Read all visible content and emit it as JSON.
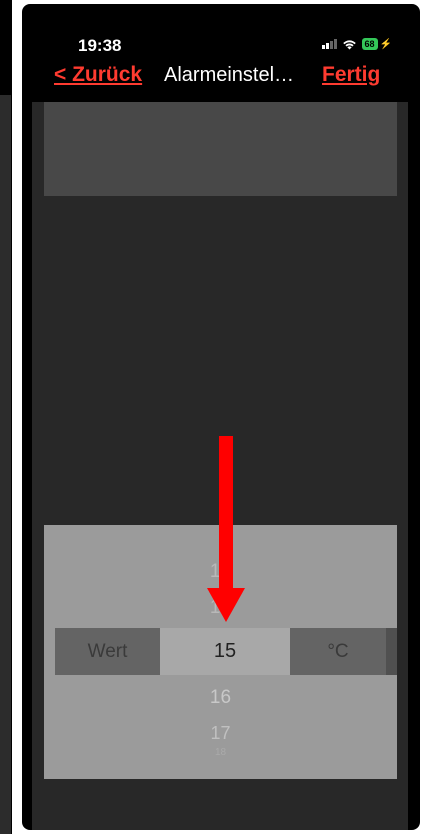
{
  "status_bar": {
    "time": "19:38",
    "battery": "68",
    "icons": [
      "signal-icon",
      "wifi-icon",
      "battery-icon"
    ]
  },
  "nav": {
    "back_label": "< Zurück",
    "title": "Alarmeinstel…",
    "done_label": "Fertig"
  },
  "picker": {
    "label": "Wert",
    "unit": "°C",
    "selected": "15",
    "values_above": [
      "13",
      "14"
    ],
    "values_below": [
      "16",
      "17",
      "18"
    ]
  },
  "annotation": {
    "arrow_color": "#ff0000",
    "icon": "down-arrow-icon"
  },
  "colors": {
    "accent": "#ff3b30",
    "battery": "#34c759",
    "background": "#282828"
  }
}
